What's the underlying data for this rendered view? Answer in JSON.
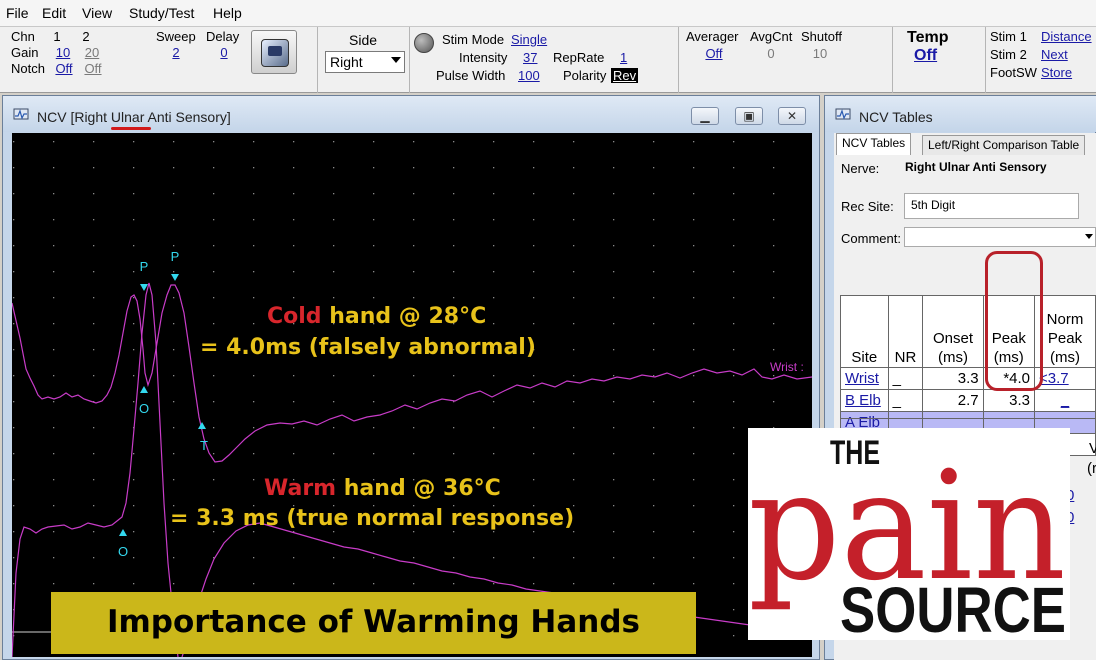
{
  "menu": [
    "File",
    "Edit",
    "View",
    "Study/Test",
    "Help"
  ],
  "toolbar": {
    "chn_label": "Chn",
    "chn1": "1",
    "chn2": "2",
    "gain_label": "Gain",
    "gain1": "10",
    "gain2": "20",
    "notch_label": "Notch",
    "notch1": "Off",
    "notch2": "Off",
    "sweep_label": "Sweep",
    "sweep_value": "2",
    "delay_label": "Delay",
    "delay_value": "0",
    "side_label": "Side",
    "side_value": "Right",
    "stim_mode_label": "Stim Mode",
    "stim_mode_value": "Single",
    "intensity_label": "Intensity",
    "intensity_value": "37",
    "reprate_label": "RepRate",
    "reprate_value": "1",
    "pulse_width_label": "Pulse Width",
    "pulse_width_value": "100",
    "polarity_label": "Polarity",
    "polarity_value": "Rev",
    "averager_label": "Averager",
    "averager_value": "Off",
    "avgcnt_label": "AvgCnt",
    "avgcnt_value": "0",
    "shutoff_label": "Shutoff",
    "shutoff_value": "10",
    "temp_label": "Temp",
    "temp_value": "Off",
    "stim1_label": "Stim 1",
    "stim1_value": "Distance",
    "stim2_label": "Stim 2",
    "stim2_value": "Next",
    "footsw_label": "FootSW",
    "footsw_value": "Store"
  },
  "ncv_window": {
    "title_prefix": "NCV [Right ",
    "title_ulnar": "Ulnar",
    "title_suffix": " Anti Sensory]",
    "minimize": "▁",
    "maximize": "▣",
    "close": "✕",
    "trace_label": "Wrist :",
    "markers": {
      "p": "P",
      "o": "O",
      "t": "T"
    }
  },
  "annotations": {
    "cold_word": "Cold",
    "cold_rest": " hand @ 28°C",
    "cold_line2": "= 4.0ms (falsely abnormal)",
    "warm_word": "Warm",
    "warm_rest": " hand @ 36°C",
    "warm_line2": "= 3.3 ms (true normal response)",
    "banner": "Importance of Warming Hands"
  },
  "tables_window": {
    "title": "NCV Tables",
    "tab_active": "NCV Tables",
    "tab_other": "Left/Right Comparison Table",
    "nerve_label": "Nerve:",
    "nerve_value": "Right Ulnar Anti Sensory",
    "rec_site_label": "Rec Site:",
    "rec_site_value": "5th Digit",
    "comment_label": "Comment:",
    "comment_value": "",
    "columns": [
      "Site",
      "NR",
      "Onset (ms)",
      "Peak (ms)",
      "Norm Peak (ms)"
    ],
    "rows": [
      {
        "site": "Wrist",
        "nr": "_",
        "onset": "3.3",
        "peak": "*4.0",
        "norm": "<3.7"
      },
      {
        "site": "B Elb",
        "nr": "_",
        "onset": "2.7",
        "peak": "3.3",
        "norm": "_"
      },
      {
        "site": "A Elb",
        "nr": "_",
        "onset": "",
        "peak": "",
        "norm": ""
      },
      {
        "site": "_",
        "nr": "",
        "onset": "",
        "peak": "",
        "norm": "_"
      }
    ],
    "lower_fragments": [
      "t",
      ")",
      "0",
      "0",
      "V",
      "(r"
    ]
  },
  "logo": {
    "the": "THE",
    "pain": "pain",
    "source": "SOURCE"
  },
  "colors": {
    "trace": "#c83cc8",
    "marker": "#33d8ee",
    "annotation": "#e8c21a",
    "annotation_red": "#d8262c",
    "banner": "#cbb71a",
    "logo_red": "#c4202a"
  }
}
